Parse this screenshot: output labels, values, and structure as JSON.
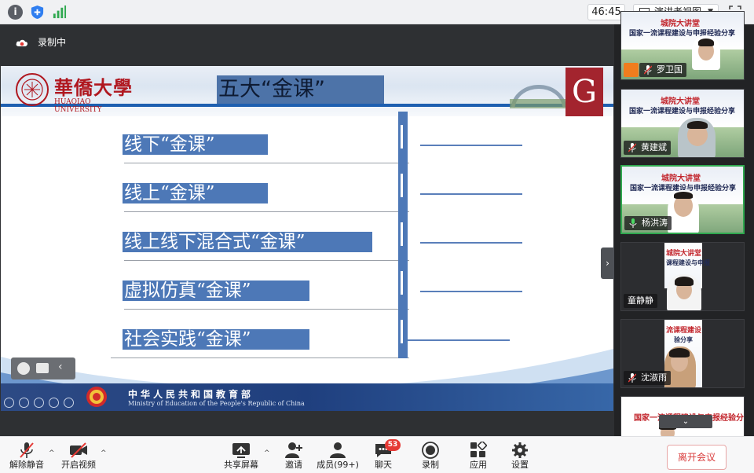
{
  "topbar": {
    "timer": "46:45",
    "presenter_view": "演讲者视图"
  },
  "meeting": {
    "recording_label": "录制中"
  },
  "slide": {
    "university_cn": "華僑大學",
    "university_en": "HUAQIAO UNIVERSITY",
    "g_logo": "G",
    "title": "五大“金课”",
    "items": [
      "线下“金课”",
      "线上“金课”",
      "线上线下混合式“金课”",
      "虚拟仿真“金课”",
      "社会实践“金课”"
    ],
    "ministry_cn": "中华人民共和国教育部",
    "ministry_en": "Ministry of Education of the People's Republic of China"
  },
  "participants": [
    {
      "name": "罗卫国",
      "slide_red": "城院大讲堂",
      "slide_sub": "国家一流课程建设与申报经验分享"
    },
    {
      "name": "黄建斌",
      "slide_red": "城院大讲堂",
      "slide_sub": "国家一流课程建设与申报经验分享"
    },
    {
      "name": "杨洪涛",
      "slide_red": "城院大讲堂",
      "slide_sub": "国家一流课程建设与申报经验分享"
    },
    {
      "name": "童静静",
      "slide_red": "城院大讲堂",
      "slide_sub": "课程建设与申报"
    },
    {
      "name": "沈淑雨",
      "slide_red": "流课程建设",
      "slide_sub": "验分享"
    },
    {
      "name": "",
      "slide_red": "",
      "slide_sub": "国家一流课程建设与申报经验分享"
    }
  ],
  "toolbar": {
    "unmute": "解除静音",
    "start_video": "开启视频",
    "share_screen": "共享屏幕",
    "invite": "邀请",
    "members": "成员(99+)",
    "chat": "聊天",
    "chat_badge": "53",
    "record": "录制",
    "apps": "应用",
    "settings": "设置",
    "leave": "离开会议"
  },
  "colors": {
    "slide_accent": "#4d78b7",
    "leave_red": "#d93a3a",
    "active_speaker": "#2fa84f"
  }
}
